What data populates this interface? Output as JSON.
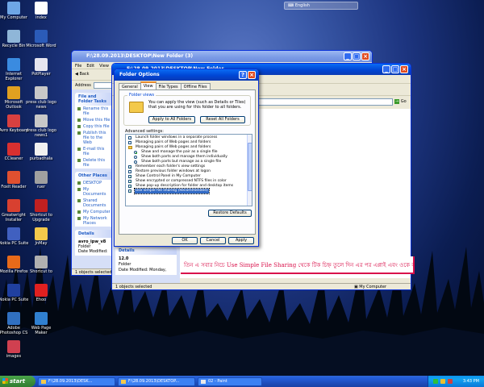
{
  "desktop": {
    "icons": [
      {
        "label": "My Computer",
        "icon": "computer-icon",
        "color": "#6ea6e6"
      },
      {
        "label": "index",
        "icon": "document-icon",
        "color": "#ffffff"
      },
      {
        "label": "Recycle Bin",
        "icon": "recycle-bin-icon",
        "color": "#8fb6d8"
      },
      {
        "label": "Microsoft Word",
        "icon": "word-icon",
        "color": "#2b5bb8"
      },
      {
        "label": "Internet Explorer",
        "icon": "ie-icon",
        "color": "#3a8be0"
      },
      {
        "label": "PotPlayer",
        "icon": "media-player-icon",
        "color": "#e6e6f0"
      },
      {
        "label": "Microsoft Outlook",
        "icon": "outlook-icon",
        "color": "#e0a020"
      },
      {
        "label": "press club logo news",
        "icon": "image-icon",
        "color": "#c8c8c8"
      },
      {
        "label": "Avro Keyboard",
        "icon": "keyboard-icon",
        "color": "#d84040"
      },
      {
        "label": "press club logo news1",
        "icon": "image-icon",
        "color": "#c8c8c8"
      },
      {
        "label": "CCleaner",
        "icon": "ccleaner-icon",
        "color": "#d83030"
      },
      {
        "label": "purbadhala",
        "icon": "document-icon",
        "color": "#f0f0f0"
      },
      {
        "label": "Foxit Reader",
        "icon": "pdf-icon",
        "color": "#e05030"
      },
      {
        "label": "ruer",
        "icon": "image-icon",
        "color": "#a0a0a0"
      },
      {
        "label": "Greatwright Installer",
        "icon": "installer-icon",
        "color": "#d84030"
      },
      {
        "label": "Shortcut to Upgrade",
        "icon": "shortcut-icon",
        "color": "#c02020"
      },
      {
        "label": "Nokia PC Suite",
        "icon": "calendar-icon",
        "color": "#4060c0"
      },
      {
        "label": "JnMay",
        "icon": "folder-icon",
        "color": "#f3c94b"
      },
      {
        "label": "Mozilla Firefox",
        "icon": "firefox-icon",
        "color": "#e86a1a"
      },
      {
        "label": "Shortcut to",
        "icon": "shortcut-icon",
        "color": "#b0b0b0"
      },
      {
        "label": "Nokia PC Suite",
        "icon": "nokia-icon",
        "color": "#2040a0"
      },
      {
        "label": "Ehoo",
        "icon": "ehoo-icon",
        "color": "#e02020"
      },
      {
        "label": "Adobe Photoshop CS",
        "icon": "photoshop-icon",
        "color": "#3070c0"
      },
      {
        "label": "Web Page Maker",
        "icon": "globe-icon",
        "color": "#3080d0"
      },
      {
        "label": "images",
        "icon": "image-icon",
        "color": "#d04050"
      }
    ],
    "language_bar": "English"
  },
  "explorer_back": {
    "title": "F:\\28.09.2013\\DESKTOP\\New Folder (3)",
    "menu": [
      "File",
      "Edit",
      "View",
      "Favorites",
      "Tools",
      "Help"
    ],
    "back_label": "Back",
    "address_label": "Address",
    "address_value": "F:\\28.09.2013\\DESKTOP\\New Folder (3)",
    "panel": {
      "file_tasks_title": "File and Folder Tasks",
      "file_tasks": [
        "Rename this file",
        "Move this file",
        "Copy this file",
        "Publish this file to the Web",
        "E-mail this file",
        "Delete this file"
      ],
      "other_places_title": "Other Places",
      "other_places": [
        "DESKTOP",
        "My Documents",
        "Shared Documents",
        "My Computer",
        "My Network Places"
      ],
      "details_title": "Details",
      "details_name": "avro_ipw_v8",
      "details_type": "Folder",
      "details_modified": "Date Modified:"
    },
    "status": "1 objects selected"
  },
  "explorer_front": {
    "title": "F:\\28.09.2013\\DESKTOP\\New Folder",
    "go_label": "Go",
    "panel": {
      "details_title": "Details",
      "details_name": "12.0",
      "details_type": "Folder",
      "details_modified": "Date Modified: Monday,"
    },
    "status": "1 objects selected",
    "status_right": "My Computer"
  },
  "folder_options": {
    "title": "Folder Options",
    "tabs": [
      "General",
      "View",
      "File Types",
      "Offline Files"
    ],
    "active_tab": "View",
    "folder_views_legend": "Folder views",
    "folder_views_text": "You can apply the view (such as Details or Tiles) that you are using for this folder to all folders.",
    "apply_all_label": "Apply to All Folders",
    "reset_all_label": "Reset All Folders",
    "advanced_label": "Advanced settings:",
    "settings": [
      {
        "type": "checkbox",
        "checked": false,
        "indent": 1,
        "label": "Launch folder windows in a separate process"
      },
      {
        "type": "checkbox",
        "checked": false,
        "indent": 1,
        "label": "Managing pairs of Web pages and folders"
      },
      {
        "type": "folder",
        "indent": 1,
        "label": "Managing pairs of Web pages and folders"
      },
      {
        "type": "radio",
        "checked": true,
        "indent": 2,
        "label": "Show and manage the pair as a single file"
      },
      {
        "type": "radio",
        "checked": false,
        "indent": 2,
        "label": "Show both parts and manage them individually"
      },
      {
        "type": "radio",
        "checked": false,
        "indent": 2,
        "label": "Show both parts but manage as a single file"
      },
      {
        "type": "checkbox",
        "checked": true,
        "indent": 1,
        "label": "Remember each folder's view settings"
      },
      {
        "type": "checkbox",
        "checked": false,
        "indent": 1,
        "label": "Restore previous folder windows at logon"
      },
      {
        "type": "checkbox",
        "checked": true,
        "indent": 1,
        "label": "Show Control Panel in My Computer"
      },
      {
        "type": "checkbox",
        "checked": true,
        "indent": 1,
        "label": "Show encrypted or compressed NTFS files in color"
      },
      {
        "type": "checkbox",
        "checked": true,
        "indent": 1,
        "label": "Show pop-up description for folder and desktop items"
      },
      {
        "type": "checkbox",
        "checked": true,
        "indent": 1,
        "selected": true,
        "label": "Use simple file sharing (Recommended)"
      }
    ],
    "restore_defaults_label": "Restore Defaults",
    "ok_label": "OK",
    "cancel_label": "Cancel",
    "apply_label": "Apply"
  },
  "bengali_note": "তিন এ সবার নিচে Use Simple File Sharing  থেকে টিক চিহ্ন তুলে দিন এর পর এপ্লাই এবং ওকে করে বের হয়ে আসুন",
  "taskbar": {
    "start_label": "start",
    "tasks": [
      {
        "label": "F:\\28.09.2013\\DESK...",
        "kind": "folder"
      },
      {
        "label": "F:\\28.09.2013\\DESKTOP...",
        "kind": "folder"
      },
      {
        "label": "02 - Paint",
        "kind": "paint"
      }
    ],
    "clock": "3:43 PM"
  }
}
